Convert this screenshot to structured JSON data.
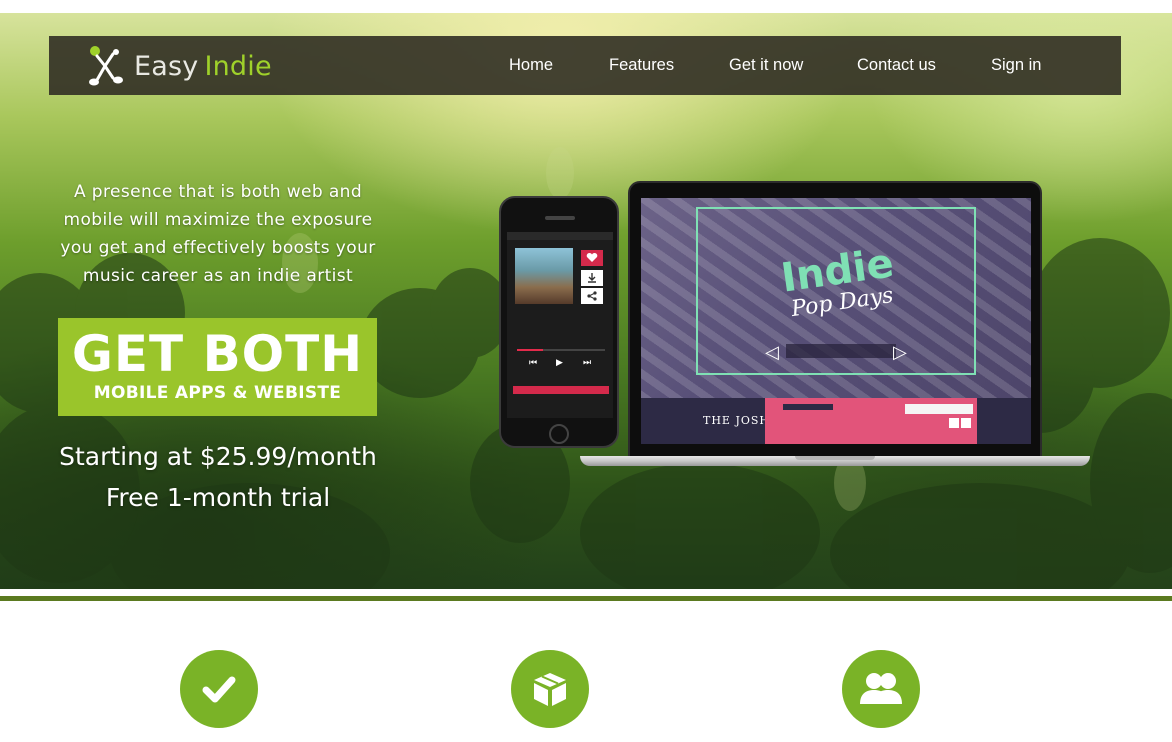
{
  "brand": {
    "name_part1": "Easy",
    "name_part2": "Indie",
    "accent_color": "#9ac52b",
    "logo_icon": "music-note-figure-icon"
  },
  "nav": {
    "items": [
      {
        "label": "Home"
      },
      {
        "label": "Features"
      },
      {
        "label": "Get it now"
      },
      {
        "label": "Contact us"
      },
      {
        "label": "Sign in"
      }
    ]
  },
  "hero": {
    "tagline": "A presence that is both web and mobile will maximize the exposure you get and effectively boosts your music career as an indie artist",
    "cta": {
      "title": "GET BOTH",
      "subtitle": "MOBILE APPS & WEBISTE"
    },
    "price_line": "Starting at $25.99/month",
    "trial_line": "Free 1-month trial",
    "devices": {
      "phone_icon": "smartphone-mockup",
      "laptop_icon": "laptop-mockup",
      "laptop_logo_1": "Indie",
      "laptop_logo_2": "Pop Days",
      "laptop_footer_name": "THE JOSH"
    }
  },
  "features": [
    {
      "icon": "checkmark-icon"
    },
    {
      "icon": "package-box-icon"
    },
    {
      "icon": "users-group-icon"
    }
  ],
  "colors": {
    "nav_background": "#34322a",
    "feature_icon_green": "#7ab327",
    "divider_green": "#5b7a20"
  }
}
